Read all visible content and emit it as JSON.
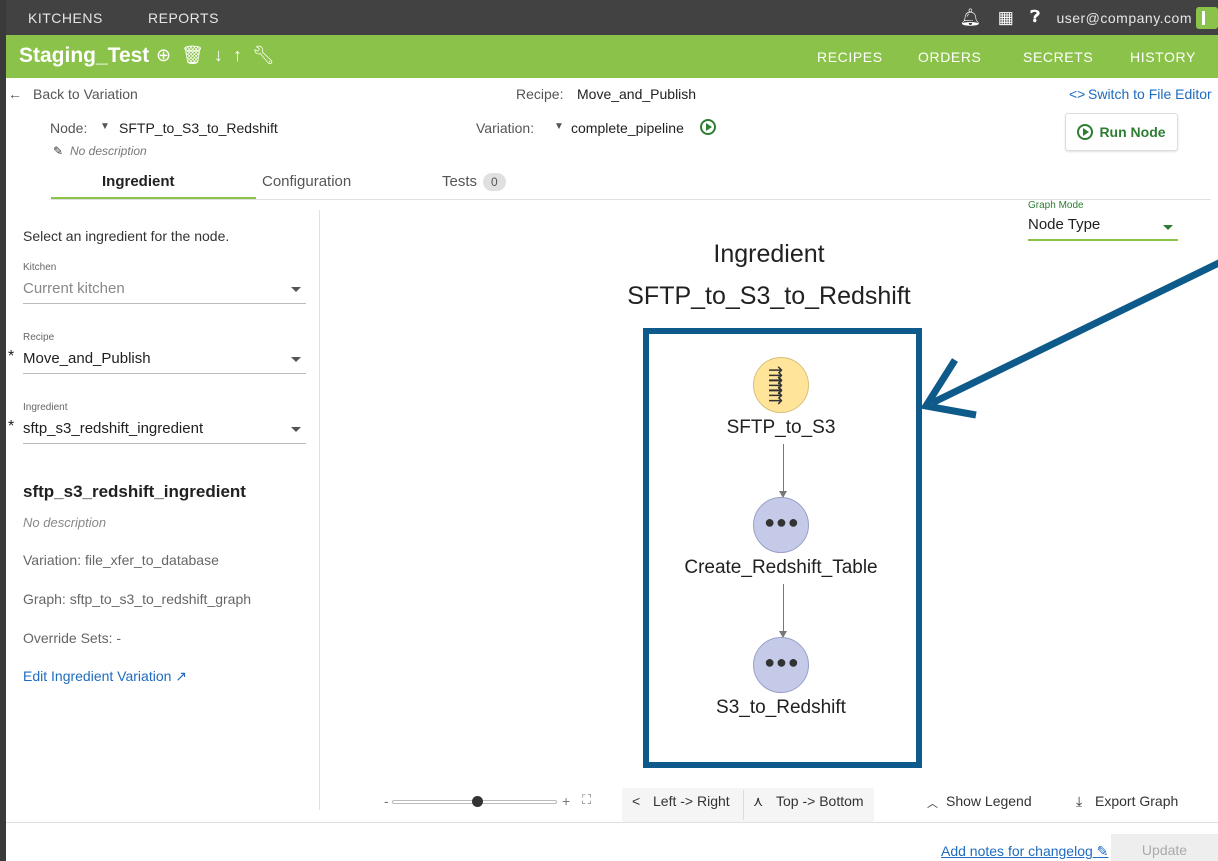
{
  "topnav": {
    "kitchens": "KITCHENS",
    "reports": "REPORTS",
    "user": "user@company.com"
  },
  "app": {
    "name": "Staging_Test"
  },
  "tabs_top": {
    "recipes": "RECIPES",
    "orders": "ORDERS",
    "secrets": "SECRETS",
    "history": "HISTORY"
  },
  "header": {
    "back": "Back to Variation",
    "recipe_label": "Recipe:",
    "recipe_value": "Move_and_Publish",
    "switch_editor": "Switch to File Editor",
    "node_label": "Node:",
    "node_value": "SFTP_to_S3_to_Redshift",
    "node_desc": "No description",
    "variation_label": "Variation:",
    "variation_value": "complete_pipeline",
    "run_node": "Run Node"
  },
  "subtabs": {
    "ingredient": "Ingredient",
    "configuration": "Configuration",
    "tests": "Tests",
    "tests_count": "0"
  },
  "left": {
    "intro": "Select an ingredient for the node.",
    "kitchen_label": "Kitchen",
    "kitchen_value": "Current kitchen",
    "recipe_label": "Recipe",
    "recipe_value": "Move_and_Publish",
    "ingredient_label": "Ingredient",
    "ingredient_value": "sftp_s3_redshift_ingredient",
    "ingredient_title": "sftp_s3_redshift_ingredient",
    "ingredient_desc": "No description",
    "variation": "Variation:  file_xfer_to_database",
    "graph": "Graph:  sftp_to_s3_to_redshift_graph",
    "override": "Override Sets:  -",
    "edit_link": "Edit Ingredient Variation"
  },
  "graph": {
    "mode_label": "Graph Mode",
    "mode_value": "Node Type",
    "title_line1": "Ingredient",
    "title_line2": "SFTP_to_S3_to_Redshift",
    "nodes": [
      "SFTP_to_S3",
      "Create_Redshift_Table",
      "S3_to_Redshift"
    ]
  },
  "toolbar": {
    "left_right": "Left -> Right",
    "top_bottom": "Top -> Bottom",
    "show_legend": "Show Legend",
    "export_graph": "Export Graph"
  },
  "footer": {
    "changelog": "Add notes for changelog",
    "update": "Update"
  },
  "colors": {
    "brand_green": "#8bc34a",
    "topnav": "#424242",
    "highlight_blue": "#0e5a8a",
    "node_purple": "#c5cae9",
    "node_yellow": "#ffe49a"
  }
}
